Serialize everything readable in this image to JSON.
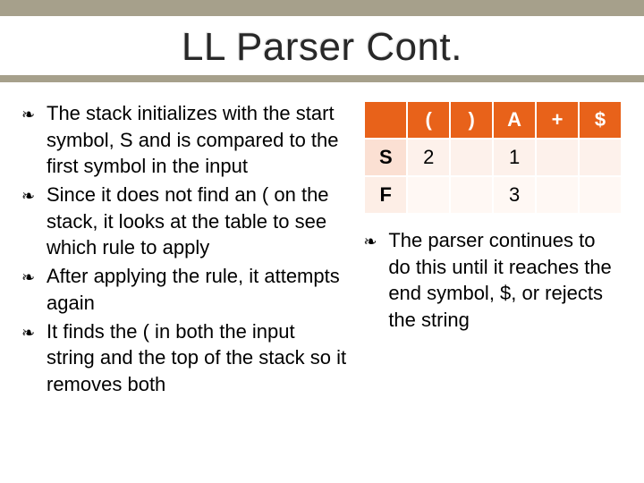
{
  "title": "LL Parser Cont.",
  "left_bullets": [
    "The stack initializes with the start symbol, S and is compared to the first symbol in the input",
    "Since it does not find an ( on the stack, it looks at the table to see which rule to apply",
    "After applying the rule, it attempts again",
    "It finds the ( in both the input string and the top of the stack so it removes both"
  ],
  "right_bullet": "The parser continues to do this until it reaches the end symbol, $, or rejects the string",
  "table": {
    "col_headers": [
      "(",
      ")",
      "A",
      "+",
      "$"
    ],
    "rows": [
      {
        "label": "S",
        "cells": [
          "2",
          "",
          "1",
          "",
          ""
        ]
      },
      {
        "label": "F",
        "cells": [
          "",
          "",
          "3",
          "",
          ""
        ]
      }
    ]
  }
}
